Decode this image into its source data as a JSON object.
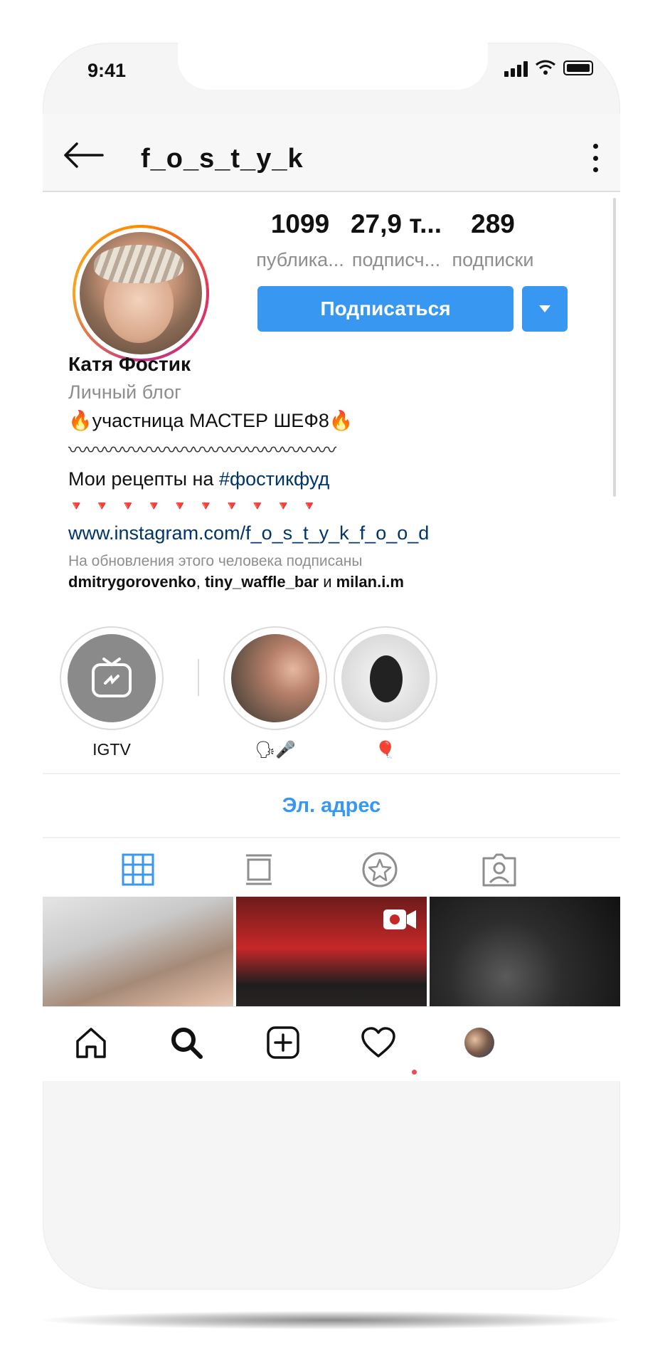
{
  "status_bar": {
    "time": "9:41"
  },
  "header": {
    "username": "f_o_s_t_y_k"
  },
  "profile": {
    "stats": [
      {
        "value": "1099",
        "label": "публика..."
      },
      {
        "value": "27,9 т...",
        "label": "подписч..."
      },
      {
        "value": "289",
        "label": "подписки"
      }
    ],
    "follow_label": "Подписаться"
  },
  "bio": {
    "name": "Катя Фостик",
    "category": "Личный блог",
    "line1": "🔥участница МАСТЕР ШЕФ8🔥",
    "wave": "〰〰〰〰〰〰〰〰〰〰〰〰〰〰〰",
    "line2_prefix": "Мои рецепты на ",
    "hashtag": "#фостикфуд",
    "hearts": "🔻🔻🔻🔻🔻🔻🔻🔻🔻🔻",
    "link": "www.instagram.com/f_o_s_t_y_k_f_o_o_d",
    "followed_note": "На обновления этого человека подписаны",
    "followed_by": [
      "dmitrygorovenko",
      "tiny_waffle_bar",
      "milan.i.m"
    ],
    "followed_sep": ", ",
    "followed_and": " и "
  },
  "highlights": [
    {
      "label": "IGTV"
    },
    {
      "label": "🗣🎤"
    },
    {
      "label": "🎈"
    }
  ],
  "email_button": "Эл. адрес",
  "colors": {
    "accent": "#3897f0",
    "link": "#003569",
    "muted": "#8e8e8e"
  }
}
